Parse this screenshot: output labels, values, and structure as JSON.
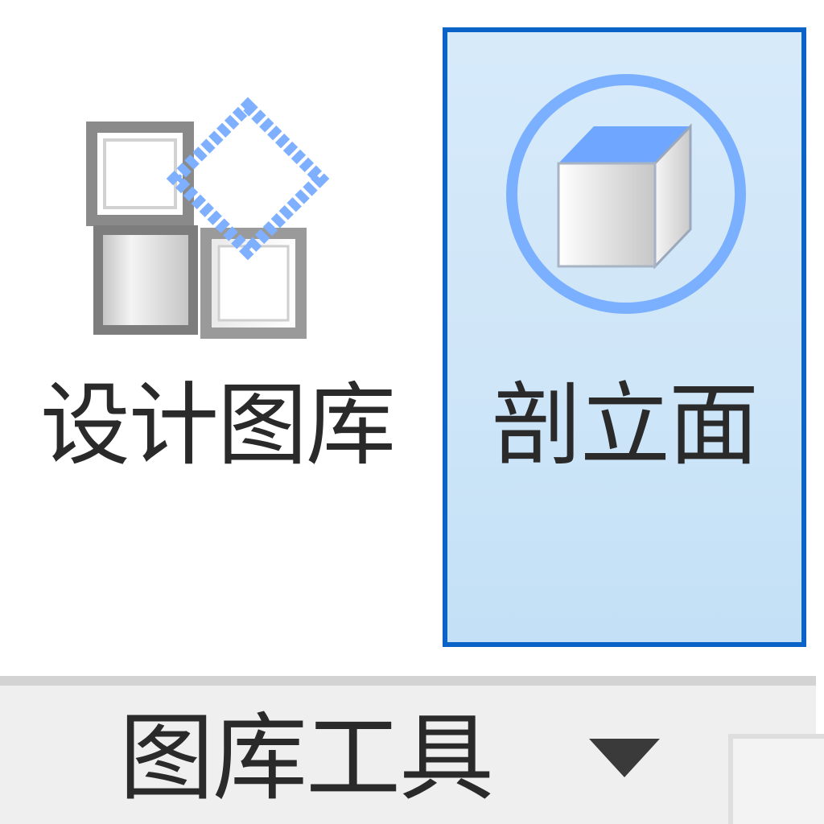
{
  "ribbon": {
    "buttons": [
      {
        "id": "design-library",
        "label": "设计图库",
        "icon": "design-library-icon",
        "selected": false
      },
      {
        "id": "elevation",
        "label": "剖立面",
        "icon": "elevation-cube-icon",
        "selected": true
      }
    ]
  },
  "group": {
    "label": "图库工具",
    "dropdown_icon": "chevron-down-icon"
  },
  "colors": {
    "selected_border": "#0a63c7",
    "selected_fill": "#cfe6f8",
    "icon_blue": "#6aa7ff",
    "group_bar": "#efefef"
  }
}
